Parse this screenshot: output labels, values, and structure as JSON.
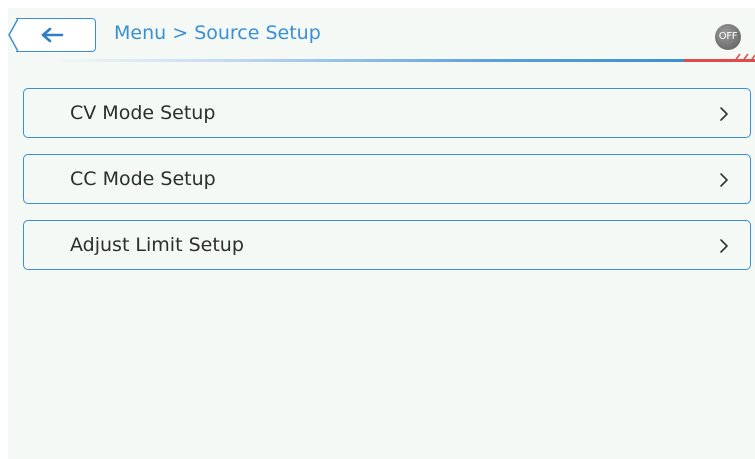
{
  "header": {
    "back_icon": "left-arrow-icon",
    "breadcrumb": {
      "root": "Menu",
      "separator": ">",
      "current": "Source Setup"
    },
    "status_badge": "OFF"
  },
  "menu": {
    "items": [
      {
        "label": "CV Mode Setup",
        "icon": "chevron-right-icon"
      },
      {
        "label": "CC Mode Setup",
        "icon": "chevron-right-icon"
      },
      {
        "label": "Adjust Limit Setup",
        "icon": "chevron-right-icon"
      }
    ]
  },
  "colors": {
    "accent": "#3a8fd4",
    "background": "#f4f9f6",
    "alert": "#e24a4a",
    "badge": "#6e6e6e",
    "text": "#2d2d2d"
  }
}
